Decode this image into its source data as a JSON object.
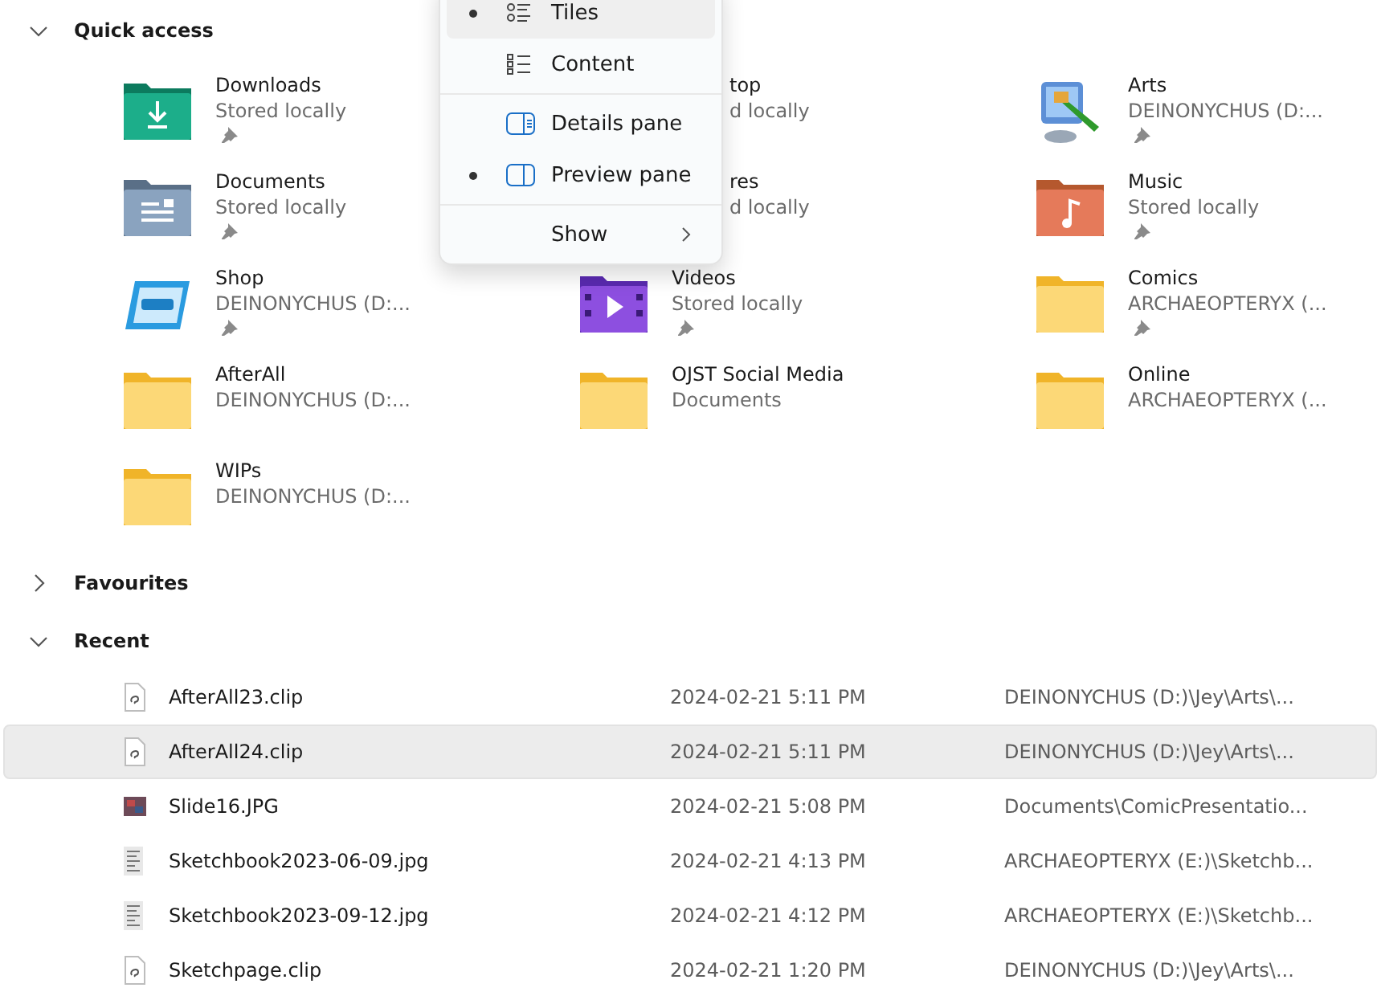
{
  "sections": [
    {
      "kind": "tiles",
      "title": "Quick access",
      "expanded": true,
      "tiles": [
        {
          "name": "Downloads",
          "detail": "Stored locally",
          "pinned": true,
          "kind": "downloads"
        },
        {
          "name": "top",
          "detail": "d locally",
          "pinned": false,
          "kind": "partial"
        },
        {
          "name": "Arts",
          "detail": "DEINONYCHUS (D:...",
          "pinned": true,
          "kind": "arts"
        },
        {
          "name": "Documents",
          "detail": "Stored locally",
          "pinned": true,
          "kind": "documents"
        },
        {
          "name": "res",
          "detail": "d locally",
          "pinned": false,
          "kind": "partial"
        },
        {
          "name": "Music",
          "detail": "Stored locally",
          "pinned": true,
          "kind": "music"
        },
        {
          "name": "Shop",
          "detail": "DEINONYCHUS (D:...",
          "pinned": true,
          "kind": "shop"
        },
        {
          "name": "Videos",
          "detail": "Stored locally",
          "pinned": true,
          "kind": "videos"
        },
        {
          "name": "Comics",
          "detail": "ARCHAEOPTERYX (...",
          "pinned": true,
          "kind": "folder"
        },
        {
          "name": "AfterAll",
          "detail": "DEINONYCHUS (D:...",
          "pinned": false,
          "kind": "folder"
        },
        {
          "name": "OJST Social Media",
          "detail": "Documents",
          "pinned": false,
          "kind": "folder"
        },
        {
          "name": "Online",
          "detail": "ARCHAEOPTERYX (...",
          "pinned": false,
          "kind": "folder"
        },
        {
          "name": "WIPs",
          "detail": "DEINONYCHUS (D:...",
          "pinned": false,
          "kind": "folder"
        }
      ]
    },
    {
      "kind": "header",
      "title": "Favourites",
      "expanded": false
    },
    {
      "kind": "files",
      "title": "Recent",
      "expanded": true,
      "files": [
        {
          "name": "AfterAll23.clip",
          "date": "2024-02-21 5:11 PM",
          "location": "DEINONYCHUS (D:)\\Jey\\Arts\\...",
          "kind": "clip",
          "selected": false
        },
        {
          "name": "AfterAll24.clip",
          "date": "2024-02-21 5:11 PM",
          "location": "DEINONYCHUS (D:)\\Jey\\Arts\\...",
          "kind": "clip",
          "selected": true
        },
        {
          "name": "Slide16.JPG",
          "date": "2024-02-21 5:08 PM",
          "location": "Documents\\ComicPresentatio...",
          "kind": "photo",
          "selected": false
        },
        {
          "name": "Sketchbook2023-06-09.jpg",
          "date": "2024-02-21 4:13 PM",
          "location": "ARCHAEOPTERYX (E:)\\Sketchb...",
          "kind": "scan",
          "selected": false
        },
        {
          "name": "Sketchbook2023-09-12.jpg",
          "date": "2024-02-21 4:12 PM",
          "location": "ARCHAEOPTERYX (E:)\\Sketchb...",
          "kind": "scan",
          "selected": false
        },
        {
          "name": "Sketchpage.clip",
          "date": "2024-02-21 1:20 PM",
          "location": "DEINONYCHUS (D:)\\Jey\\Arts\\...",
          "kind": "clip",
          "selected": false
        }
      ]
    }
  ],
  "view_menu": {
    "groups": [
      [
        {
          "label": "Tiles",
          "kind": "option",
          "checked": true,
          "highlighted": true
        },
        {
          "label": "Content",
          "kind": "option",
          "checked": false,
          "highlighted": false
        }
      ],
      [
        {
          "label": "Details pane",
          "kind": "option",
          "checked": false,
          "highlighted": false
        },
        {
          "label": "Preview pane",
          "kind": "option",
          "checked": true,
          "highlighted": false
        }
      ],
      [
        {
          "label": "Show",
          "kind": "submenu",
          "highlighted": false
        }
      ]
    ]
  }
}
